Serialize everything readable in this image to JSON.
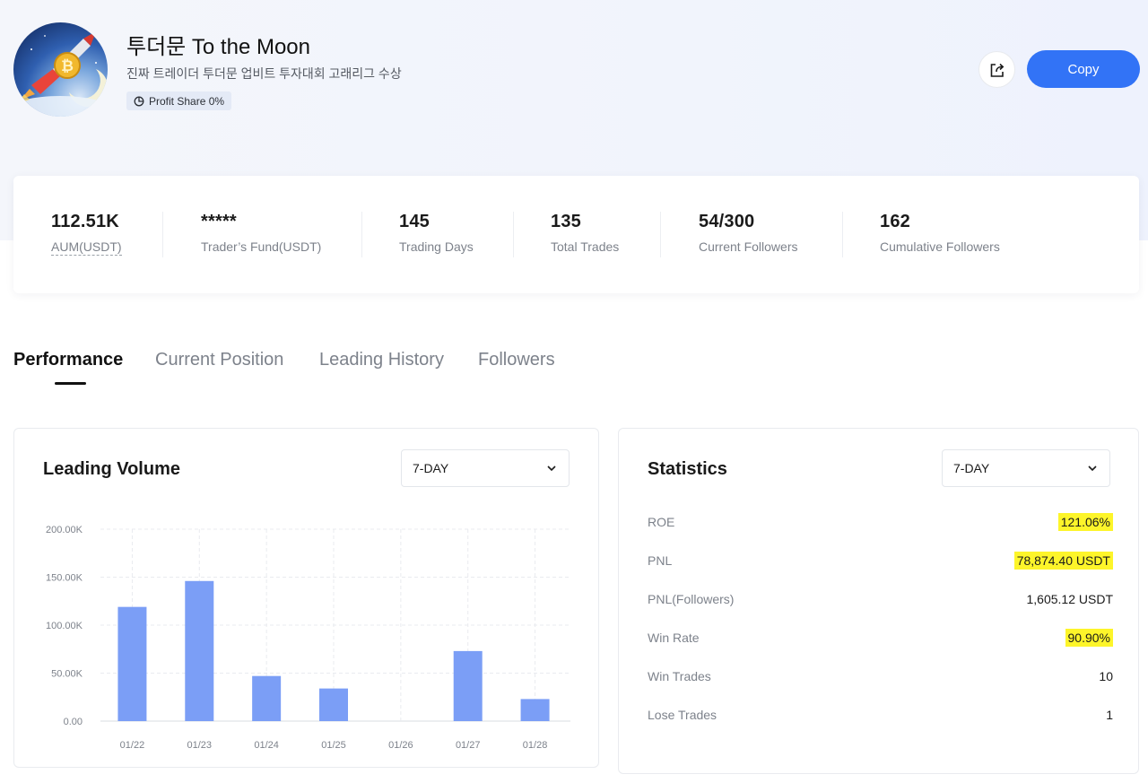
{
  "profile": {
    "name": "투더문 To the Moon",
    "bio": "진짜 트레이더 투더문 업비트 투자대회 고래리그 수상",
    "profit_share": "Profit Share 0%",
    "copy_label": "Copy"
  },
  "stats": [
    {
      "value": "112.51K",
      "label": "AUM(USDT)"
    },
    {
      "value": "*****",
      "label": "Trader’s Fund(USDT)"
    },
    {
      "value": "145",
      "label": "Trading Days"
    },
    {
      "value": "135",
      "label": "Total Trades"
    },
    {
      "value": "54/300",
      "label": "Current Followers"
    },
    {
      "value": "162",
      "label": "Cumulative Followers"
    }
  ],
  "tabs": [
    "Performance",
    "Current Position",
    "Leading History",
    "Followers"
  ],
  "leading_volume": {
    "title": "Leading Volume",
    "period": "7-DAY"
  },
  "statistics": {
    "title": "Statistics",
    "period": "7-DAY",
    "rows": [
      {
        "key": "ROE",
        "value": "121.06%"
      },
      {
        "key": "PNL",
        "value": "78,874.40 USDT"
      },
      {
        "key": "PNL(Followers)",
        "value": "1,605.12 USDT"
      },
      {
        "key": "Win Rate",
        "value": "90.90%"
      },
      {
        "key": "Win Trades",
        "value": "10"
      },
      {
        "key": "Lose Trades",
        "value": "1"
      }
    ]
  },
  "colors": {
    "accent": "#3273f6",
    "bar": "#7b9ef6",
    "highlight": "#fdf52a"
  },
  "chart_data": {
    "type": "bar",
    "categories": [
      "01/22",
      "01/23",
      "01/24",
      "01/25",
      "01/26",
      "01/27",
      "01/28"
    ],
    "values": [
      119000,
      146000,
      47000,
      34000,
      0,
      73000,
      23000
    ],
    "y_ticks": [
      "0.00",
      "50.00K",
      "100.00K",
      "150.00K",
      "200.00K"
    ],
    "ylim": [
      0,
      200000
    ],
    "grid": true
  }
}
